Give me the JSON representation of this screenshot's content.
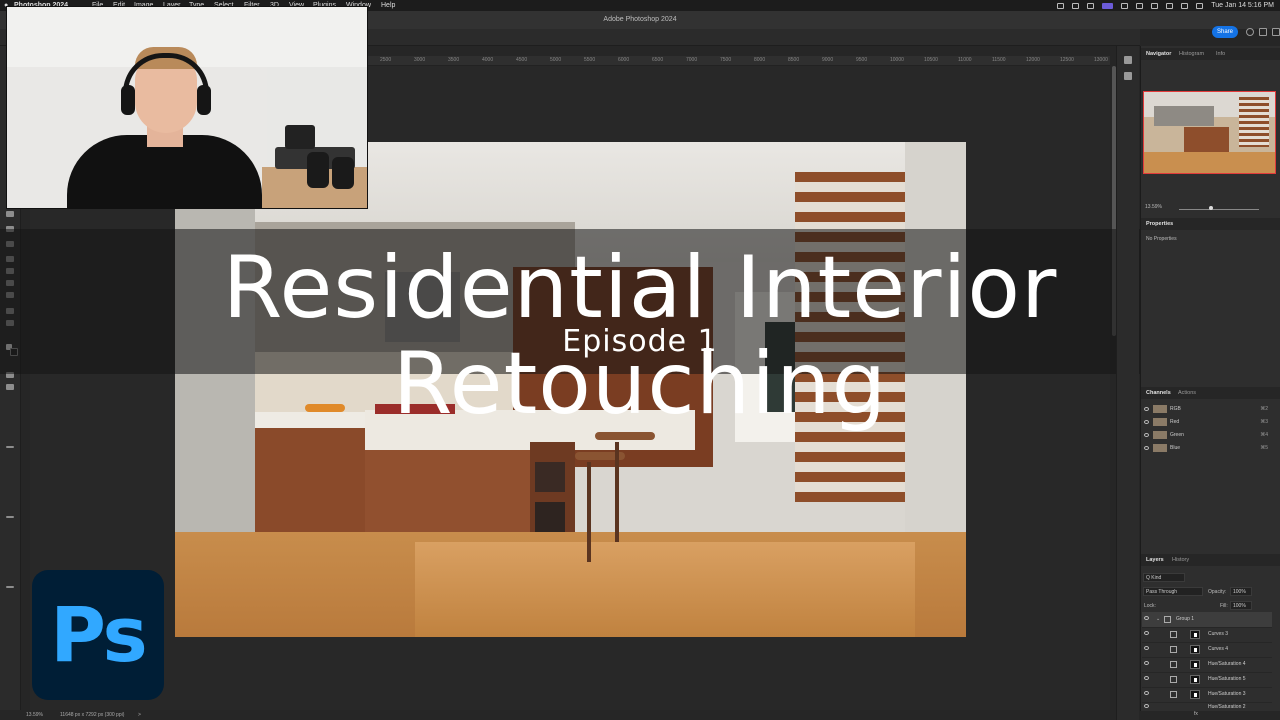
{
  "menubar": {
    "app": "Photoshop 2024",
    "items": [
      "File",
      "Edit",
      "Image",
      "Layer",
      "Type",
      "Select",
      "Filter",
      "3D",
      "View",
      "Plugins",
      "Window",
      "Help"
    ],
    "clock": "Tue Jan 14  5:16 PM"
  },
  "window": {
    "title": "Adobe Photoshop 2024",
    "share_label": "Share"
  },
  "ruler": {
    "ticks": [
      "2500",
      "3000",
      "3500",
      "4000",
      "4500",
      "5000",
      "5500",
      "6000",
      "6500",
      "7000",
      "7500",
      "8000",
      "8500",
      "9000",
      "9500",
      "10000",
      "10500",
      "11000",
      "11500",
      "12000",
      "12500",
      "13000"
    ]
  },
  "overlay": {
    "title": "Residential Interior Retouching",
    "subtitle": "Episode 1"
  },
  "logo": {
    "text": "Ps",
    "bg": "#001e36",
    "fg": "#31a8ff"
  },
  "status": {
    "zoom": "13.59%",
    "doc": "11648 px x 7292 px (300 ppi)",
    "arrow": ">"
  },
  "navigator": {
    "tabs": [
      "Navigator",
      "Histogram",
      "Info"
    ],
    "zoom": "13.59%"
  },
  "properties": {
    "title": "Properties",
    "empty": "No Properties"
  },
  "channels": {
    "tabs": [
      "Channels",
      "Actions"
    ],
    "rows": [
      {
        "name": "RGB",
        "shortcut": "⌘2"
      },
      {
        "name": "Red",
        "shortcut": "⌘3"
      },
      {
        "name": "Green",
        "shortcut": "⌘4"
      },
      {
        "name": "Blue",
        "shortcut": "⌘5"
      }
    ]
  },
  "layers": {
    "tabs": [
      "Layers",
      "History"
    ],
    "kind": "Q Kind",
    "blend": "Pass Through",
    "opacity_label": "Opacity:",
    "opacity": "100%",
    "lock_label": "Lock:",
    "fill_label": "Fill:",
    "fill": "100%",
    "group": "Group 1",
    "rows": [
      "Curves 3",
      "Curves 4",
      "Hue/Saturation 4",
      "Hue/Saturation 5",
      "Hue/Saturation 3",
      "Hue/Saturation 2"
    ]
  }
}
